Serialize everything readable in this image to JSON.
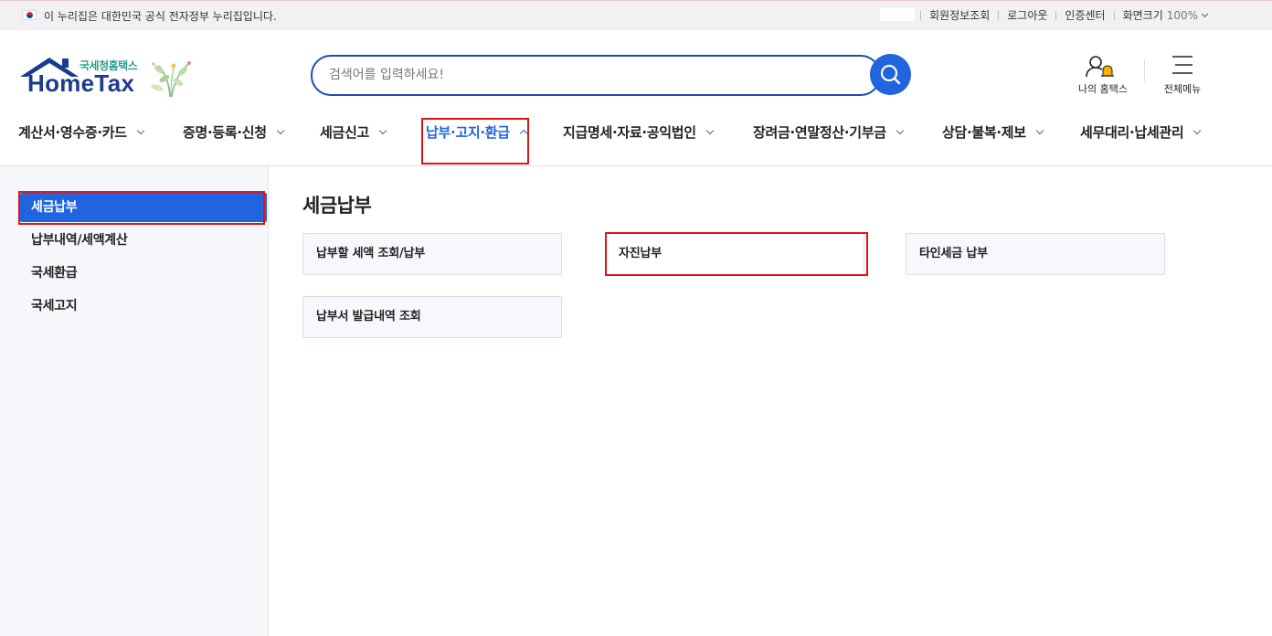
{
  "gov_bar": {
    "notice": "이 누리집은 대한민국 공식 전자정부 누리집입니다.",
    "links": [
      "회원정보조회",
      "로그아웃",
      "인증센터",
      "화면크기"
    ],
    "zoom": "100%"
  },
  "header": {
    "logo_sub": "국세청홈택스",
    "logo_main": "HomeTax",
    "search_placeholder": "검색어를 입력하세요!",
    "my_hometax": "나의 홈택스",
    "all_menu": "전체메뉴"
  },
  "gnb": {
    "items": [
      "계산서·영수증·카드",
      "증명·등록·신청",
      "세금신고",
      "납부·고지·환급",
      "지급명세·자료·공익법인",
      "장려금·연말정산·기부금",
      "상담·불복·제보",
      "세무대리·납세관리"
    ],
    "active_index": 3
  },
  "sidebar": {
    "items": [
      "세금납부",
      "납부내역/세액계산",
      "국세환급",
      "국세고지"
    ],
    "active_index": 0
  },
  "main": {
    "title": "세금납부",
    "cards": [
      "납부할 세액 조회/납부",
      "자진납부",
      "타인세금 납부",
      "납부서 발급내역 조회"
    ]
  },
  "colors": {
    "accent": "#2064e0",
    "highlight": "#e01414",
    "logo_blue": "#1b3c8e"
  }
}
